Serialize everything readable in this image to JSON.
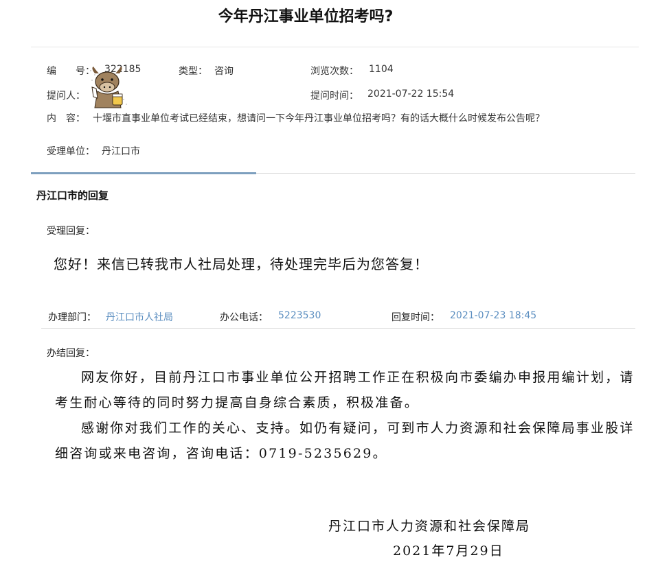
{
  "question": {
    "title": "今年丹江事业单位招考吗?",
    "number_label": "编　　号：",
    "number_value": "322185",
    "type_label": "类型：",
    "type_value": "咨询",
    "views_label": "浏览次数：",
    "views_value": "1104",
    "asker_label": "提问人：",
    "asked_time_label": "提问时间：",
    "asked_time_value": "2021-07-22 15:54",
    "content_label": "内　容：",
    "content_value": "十堰市直事业单位考试已经结束，想请问一下今年丹江事业单位招考吗？有的话大概什么时候发布公告呢？",
    "unit_label": "受理单位：",
    "unit_value": "丹江口市"
  },
  "reply": {
    "header": "丹江口市的回复",
    "accept_label": "受理回复：",
    "accept_text": "您好！来信已转我市人社局处理，待处理完毕后为您答复！",
    "dept_label": "办理部门：",
    "dept_value": "丹江口市人社局",
    "phone_label": "办公电话：",
    "phone_value": "5223530",
    "time_label": "回复时间：",
    "time_value": "2021-07-23 18:45",
    "final_label": "办结回复：",
    "final_para1": "网友你好，目前丹江口市事业单位公开招聘工作正在积极向市委编办申报用编计划，请考生耐心等待的同时努力提高自身综合素质，积极准备。",
    "final_para2": "感谢你对我们工作的关心、支持。如仍有疑问，可到市人力资源和社会保障局事业股详细咨询或来电咨询，咨询电话：0719-5235629。",
    "sign_org": "丹江口市人力资源和社会保障局",
    "sign_date": "2021年7月29日"
  },
  "colors": {
    "accent_blue": "#5b8ec0",
    "tab_accent": "#7d9fbe"
  }
}
